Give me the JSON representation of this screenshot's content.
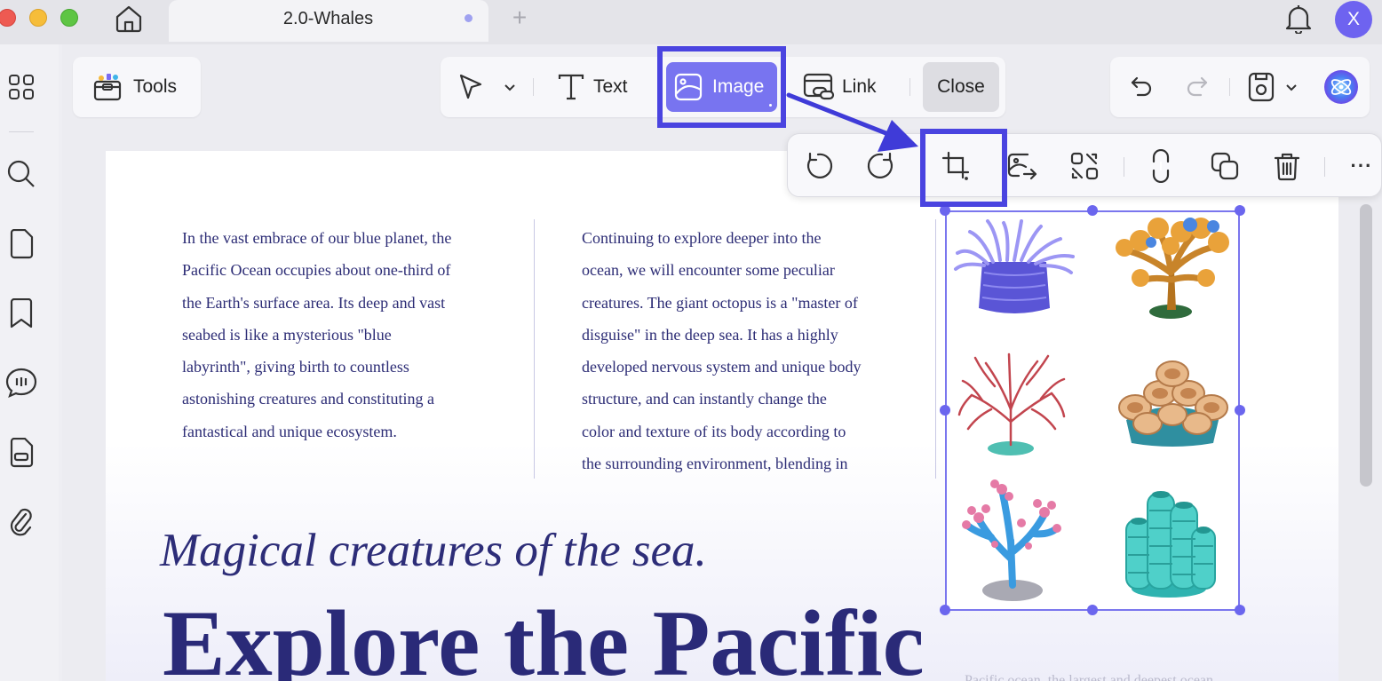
{
  "titlebar": {
    "tab_title": "2.0-Whales",
    "new_tab": "+",
    "avatar_letter": "X"
  },
  "toolbar": {
    "tools_label": "Tools",
    "text_label": "Text",
    "image_label": "Image",
    "link_label": "Link",
    "close_label": "Close"
  },
  "image_toolbar": {
    "more_label": "···"
  },
  "document": {
    "column1": [
      "In the vast embrace of our blue planet, the",
      "Pacific Ocean occupies about one-third of",
      "the Earth's surface area. Its deep and vast",
      "seabed is like a mysterious \"blue",
      "labyrinth\", giving birth to countless",
      "astonishing creatures and constituting a",
      "fantastical and unique ecosystem."
    ],
    "column2": [
      "Continuing to explore deeper into the",
      "ocean, we will encounter some peculiar",
      "creatures. The giant octopus is a \"master of",
      "disguise\" in the deep sea. It has a highly",
      "developed nervous system and unique body",
      "structure, and can instantly change the",
      "color and texture of its body according to",
      "the surrounding environment, blending in"
    ],
    "subtitle": "Magical creatures of the sea.",
    "headline": "Explore the Pacific",
    "faint_text": "Pacific ocean, the largest and deepest ocean"
  },
  "colors": {
    "accent": "#7874f0",
    "highlight": "#4a44e0",
    "doc_text": "#2c2c75"
  }
}
